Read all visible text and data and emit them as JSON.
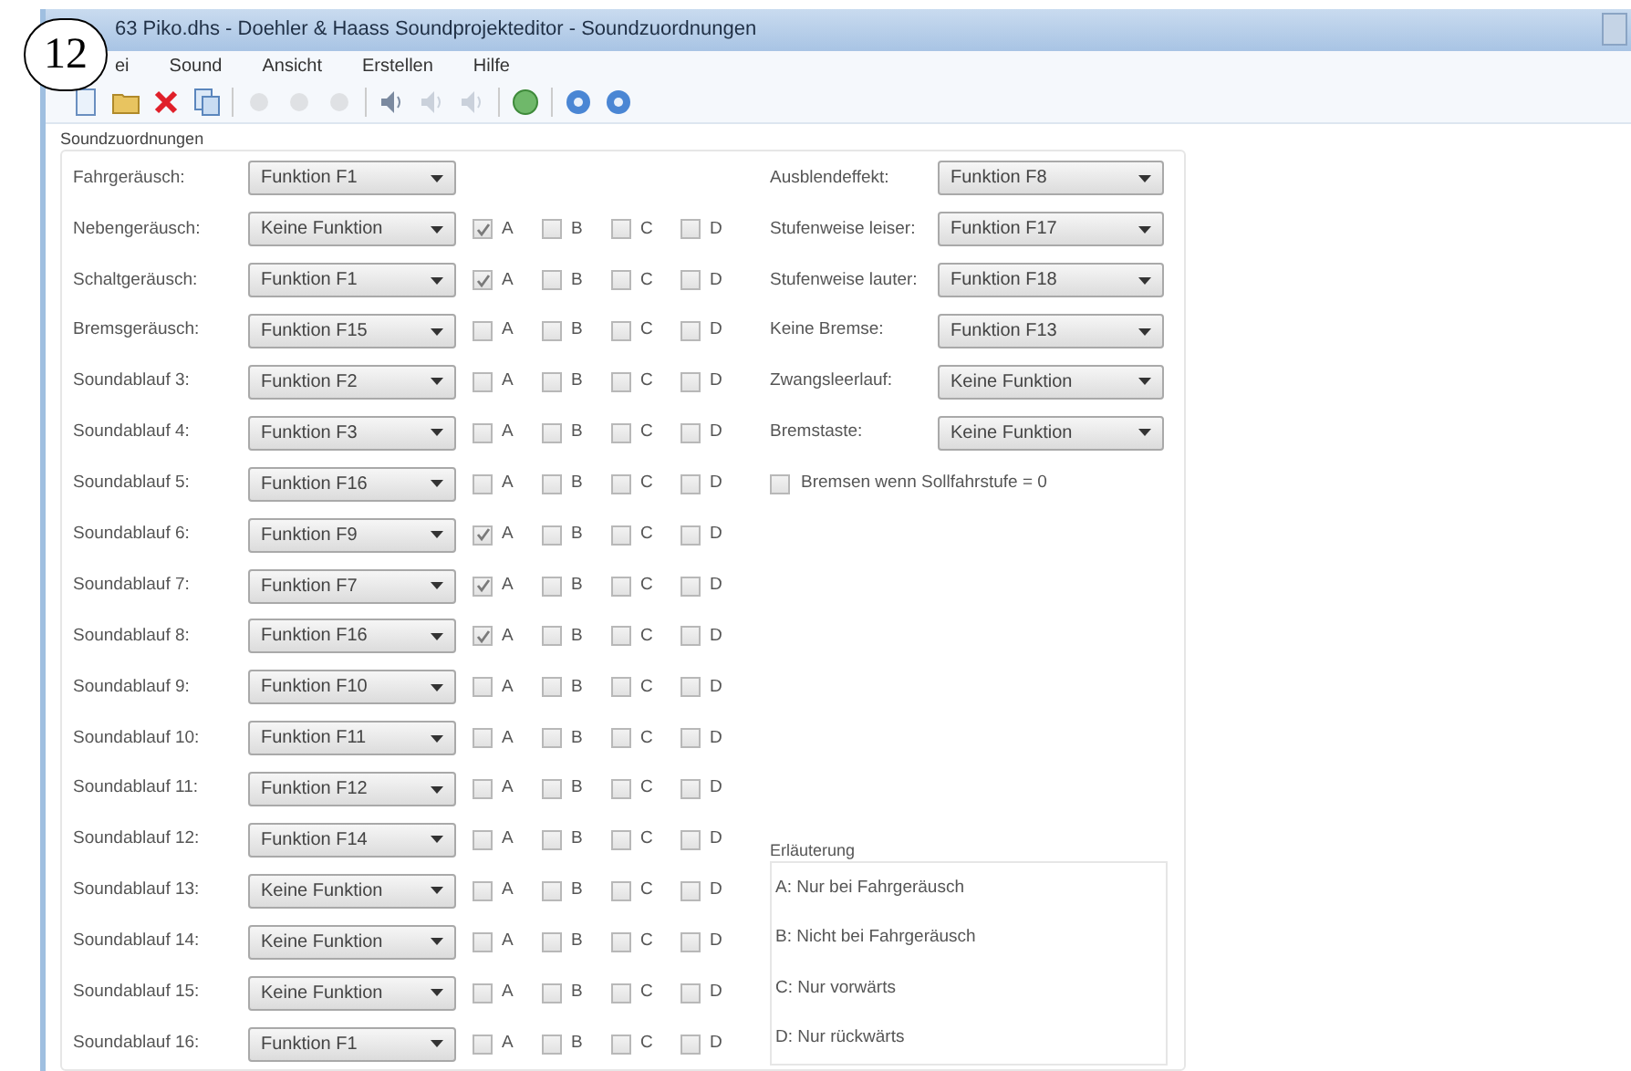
{
  "badge": "12",
  "window": {
    "title": "63 Piko.dhs - Doehler & Haass Soundprojekteditor - Soundzuordnungen"
  },
  "menu": [
    "ei",
    "Sound",
    "Ansicht",
    "Erstellen",
    "Hilfe"
  ],
  "group": {
    "title": "Soundzuordnungen",
    "rows": [
      {
        "label": "Fahrgeräusch:",
        "value": "Funktion F1"
      },
      {
        "label": "Nebengeräusch:",
        "value": "Keine Funktion",
        "options": [
          {
            "label": "A",
            "checked": true
          },
          {
            "label": "B",
            "checked": false
          },
          {
            "label": "C",
            "checked": false
          },
          {
            "label": "D",
            "checked": false
          }
        ]
      },
      {
        "label": "Schaltgeräusch:",
        "value": "Funktion F1",
        "options": [
          {
            "label": "A",
            "checked": true
          },
          {
            "label": "B",
            "checked": false
          },
          {
            "label": "C",
            "checked": false
          },
          {
            "label": "D",
            "checked": false
          }
        ]
      },
      {
        "label": "Bremsgeräusch:",
        "value": "Funktion F15",
        "options": [
          {
            "label": "A",
            "checked": false
          },
          {
            "label": "B",
            "checked": false
          },
          {
            "label": "C",
            "checked": false
          },
          {
            "label": "D",
            "checked": false
          }
        ]
      },
      {
        "label": "Soundablauf 3:",
        "value": "Funktion F2",
        "options": [
          {
            "label": "A",
            "checked": false
          },
          {
            "label": "B",
            "checked": false
          },
          {
            "label": "C",
            "checked": false
          },
          {
            "label": "D",
            "checked": false
          }
        ]
      },
      {
        "label": "Soundablauf 4:",
        "value": "Funktion F3",
        "options": [
          {
            "label": "A",
            "checked": false
          },
          {
            "label": "B",
            "checked": false
          },
          {
            "label": "C",
            "checked": false
          },
          {
            "label": "D",
            "checked": false
          }
        ]
      },
      {
        "label": "Soundablauf 5:",
        "value": "Funktion F16",
        "options": [
          {
            "label": "A",
            "checked": false
          },
          {
            "label": "B",
            "checked": false
          },
          {
            "label": "C",
            "checked": false
          },
          {
            "label": "D",
            "checked": false
          }
        ]
      },
      {
        "label": "Soundablauf 6:",
        "value": "Funktion F9",
        "options": [
          {
            "label": "A",
            "checked": true
          },
          {
            "label": "B",
            "checked": false
          },
          {
            "label": "C",
            "checked": false
          },
          {
            "label": "D",
            "checked": false
          }
        ]
      },
      {
        "label": "Soundablauf 7:",
        "value": "Funktion F7",
        "options": [
          {
            "label": "A",
            "checked": true
          },
          {
            "label": "B",
            "checked": false
          },
          {
            "label": "C",
            "checked": false
          },
          {
            "label": "D",
            "checked": false
          }
        ]
      },
      {
        "label": "Soundablauf 8:",
        "value": "Funktion F16",
        "options": [
          {
            "label": "A",
            "checked": true
          },
          {
            "label": "B",
            "checked": false
          },
          {
            "label": "C",
            "checked": false
          },
          {
            "label": "D",
            "checked": false
          }
        ]
      },
      {
        "label": "Soundablauf 9:",
        "value": "Funktion F10",
        "options": [
          {
            "label": "A",
            "checked": false
          },
          {
            "label": "B",
            "checked": false
          },
          {
            "label": "C",
            "checked": false
          },
          {
            "label": "D",
            "checked": false
          }
        ]
      },
      {
        "label": "Soundablauf 10:",
        "value": "Funktion F11",
        "options": [
          {
            "label": "A",
            "checked": false
          },
          {
            "label": "B",
            "checked": false
          },
          {
            "label": "C",
            "checked": false
          },
          {
            "label": "D",
            "checked": false
          }
        ]
      },
      {
        "label": "Soundablauf 11:",
        "value": "Funktion F12",
        "options": [
          {
            "label": "A",
            "checked": false
          },
          {
            "label": "B",
            "checked": false
          },
          {
            "label": "C",
            "checked": false
          },
          {
            "label": "D",
            "checked": false
          }
        ]
      },
      {
        "label": "Soundablauf 12:",
        "value": "Funktion F14",
        "options": [
          {
            "label": "A",
            "checked": false
          },
          {
            "label": "B",
            "checked": false
          },
          {
            "label": "C",
            "checked": false
          },
          {
            "label": "D",
            "checked": false
          }
        ]
      },
      {
        "label": "Soundablauf 13:",
        "value": "Keine Funktion",
        "options": [
          {
            "label": "A",
            "checked": false
          },
          {
            "label": "B",
            "checked": false
          },
          {
            "label": "C",
            "checked": false
          },
          {
            "label": "D",
            "checked": false
          }
        ]
      },
      {
        "label": "Soundablauf 14:",
        "value": "Keine Funktion",
        "options": [
          {
            "label": "A",
            "checked": false
          },
          {
            "label": "B",
            "checked": false
          },
          {
            "label": "C",
            "checked": false
          },
          {
            "label": "D",
            "checked": false
          }
        ]
      },
      {
        "label": "Soundablauf 15:",
        "value": "Keine Funktion",
        "options": [
          {
            "label": "A",
            "checked": false
          },
          {
            "label": "B",
            "checked": false
          },
          {
            "label": "C",
            "checked": false
          },
          {
            "label": "D",
            "checked": false
          }
        ]
      },
      {
        "label": "Soundablauf 16:",
        "value": "Funktion F1",
        "options": [
          {
            "label": "A",
            "checked": false
          },
          {
            "label": "B",
            "checked": false
          },
          {
            "label": "C",
            "checked": false
          },
          {
            "label": "D",
            "checked": false
          }
        ]
      }
    ],
    "settings": [
      {
        "label": "Ausblendeffekt:",
        "value": "Funktion F8"
      },
      {
        "label": "Stufenweise leiser:",
        "value": "Funktion F17"
      },
      {
        "label": "Stufenweise lauter:",
        "value": "Funktion F18"
      },
      {
        "label": "Keine Bremse:",
        "value": "Funktion F13"
      },
      {
        "label": "Zwangsleerlauf:",
        "value": "Keine Funktion"
      },
      {
        "label": "Bremstaste:",
        "value": "Keine Funktion"
      }
    ],
    "brake_option": {
      "label": "Bremsen wenn Sollfahrstufe = 0",
      "checked": false
    },
    "legend": {
      "title": "Erläuterung",
      "lines": [
        "A: Nur bei Fahrgeräusch",
        "B: Nicht bei Fahrgeräusch",
        "C: Nur vorwärts",
        "D: Nur rückwärts"
      ]
    }
  }
}
